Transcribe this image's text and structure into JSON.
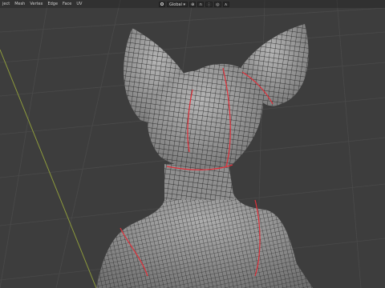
{
  "menu": {
    "items": [
      "ject",
      "Mesh",
      "Vertex",
      "Edge",
      "Face",
      "UV"
    ]
  },
  "toolbar": {
    "transform_orientation": "Global",
    "pivot_icon": "pivot-icon",
    "snap_icon": "magnet-icon",
    "proportional_icon": "proportional-edit-icon",
    "dropdown_icon": "chevron-down-icon"
  },
  "colors": {
    "viewport_bg": "#3d3d3d",
    "grid_line": "#4a4a4a",
    "y_axis": "#8d9a3c",
    "mesh_face": "#9a9a9a",
    "wire": "#111111",
    "seam": "#e0303a"
  }
}
